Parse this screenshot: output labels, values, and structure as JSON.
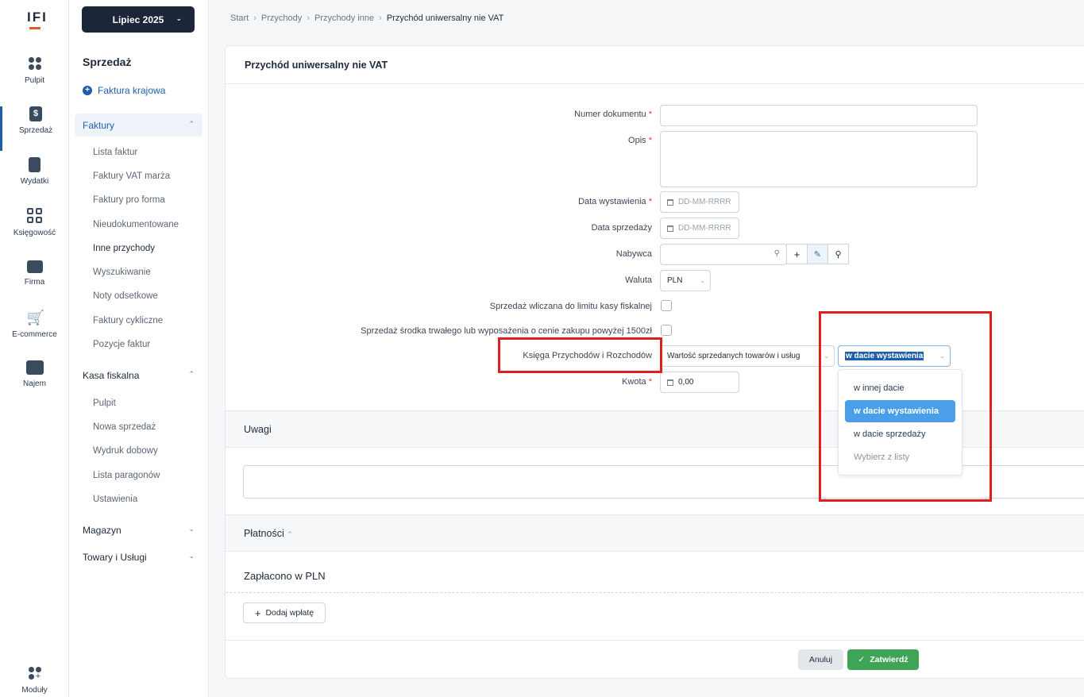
{
  "logo": "IFI",
  "rail": [
    {
      "label": "Pulpit",
      "icon": "dashboard-icon"
    },
    {
      "label": "Sprzedaż",
      "icon": "invoice-icon"
    },
    {
      "label": "Wydatki",
      "icon": "receipt-icon"
    },
    {
      "label": "Księgowość",
      "icon": "calculator-icon"
    },
    {
      "label": "Firma",
      "icon": "briefcase-icon"
    },
    {
      "label": "E-commerce",
      "icon": "cart-icon"
    },
    {
      "label": "Najem",
      "icon": "building-icon"
    },
    {
      "label": "Moduły",
      "icon": "modules-icon"
    }
  ],
  "sidebar": {
    "period": "Lipiec 2025",
    "title": "Sprzedaż",
    "add_label": "Faktura krajowa",
    "groups": {
      "faktury": "Faktury",
      "kasa": "Kasa fiskalna",
      "magazyn": "Magazyn",
      "towary": "Towary i Usługi"
    },
    "faktury_items": [
      "Lista faktur",
      "Faktury VAT marża",
      "Faktury pro forma",
      "Nieudokumentowane",
      "Inne przychody",
      "Wyszukiwanie",
      "Noty odsetkowe",
      "Faktury cykliczne",
      "Pozycje faktur"
    ],
    "kasa_items": [
      "Pulpit",
      "Nowa sprzedaż",
      "Wydruk dobowy",
      "Lista paragonów",
      "Ustawienia"
    ]
  },
  "breadcrumb": [
    "Start",
    "Przychody",
    "Przychody inne",
    "Przychód uniwersalny nie VAT"
  ],
  "form": {
    "title": "Przychód uniwersalny nie VAT",
    "numer_label": "Numer dokumentu",
    "opis_label": "Opis",
    "data_wyst_label": "Data wystawienia",
    "data_sprz_label": "Data sprzedaży",
    "date_placeholder": "DD-MM-RRRR",
    "nabywca_label": "Nabywca",
    "waluta_label": "Waluta",
    "waluta_value": "PLN",
    "kasa_label": "Sprzedaż wliczana do limitu kasy fiskalnej",
    "srodek_label": "Sprzedaż środka trwałego lub wyposażenia o cenie zakupu powyżej 1500zł",
    "kpir_label": "Księga Przychodów i Rozchodów",
    "kpir_value": "Wartość sprzedanych towarów i usług",
    "date_mode_value": "w dacie wystawienia",
    "kwota_label": "Kwota",
    "kwota_value": "0,00",
    "required_mark": "*"
  },
  "dropdown_options": [
    "w innej dacie",
    "w dacie wystawienia",
    "w dacie sprzedaży",
    "Wybierz z listy"
  ],
  "uwagi_title": "Uwagi",
  "platnosci_title": "Płatności",
  "zaplacono_title": "Zapłacono w PLN",
  "add_payment_label": "Dodaj wpłatę",
  "cancel_label": "Anuluj",
  "submit_label": "Zatwierdź",
  "colors": {
    "accent": "#1e5fa8",
    "submit": "#3fa455",
    "highlight": "#e02020",
    "selected_option": "#4a9fe8"
  }
}
